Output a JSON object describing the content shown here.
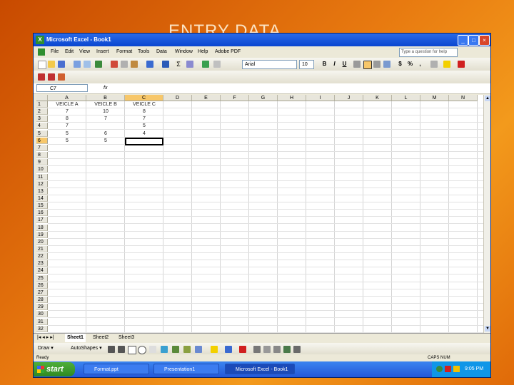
{
  "slide": {
    "title": "ENTRY DATA"
  },
  "window": {
    "title": "Microsoft Excel - Book1",
    "app_icon": "X",
    "minimize": "_",
    "maximize": "□",
    "close": "×"
  },
  "menu": {
    "items": [
      "File",
      "Edit",
      "View",
      "Insert",
      "Format",
      "Tools",
      "Data",
      "Window",
      "Help",
      "Adobe PDF"
    ],
    "help_placeholder": "Type a question for help"
  },
  "format_toolbar": {
    "font_name": "Arial",
    "font_size": "10",
    "bold": "B",
    "italic": "I",
    "underline": "U",
    "currency": "$",
    "percent": "%",
    "comma": ","
  },
  "formula_bar": {
    "name_box": "C7",
    "fx": "fx",
    "value": ""
  },
  "sheet": {
    "columns": [
      "A",
      "B",
      "C",
      "D",
      "E",
      "F",
      "G",
      "H",
      "I",
      "J",
      "K",
      "L",
      "M",
      "N"
    ],
    "rows": [
      "1",
      "2",
      "3",
      "4",
      "5",
      "6",
      "7",
      "8",
      "9",
      "10",
      "11",
      "12",
      "13",
      "14",
      "15",
      "16",
      "17",
      "18",
      "19",
      "20",
      "21",
      "22",
      "23",
      "24",
      "25",
      "26",
      "27",
      "28",
      "29",
      "30",
      "31",
      "32"
    ],
    "cells": [
      {
        "row": 1,
        "col": "A",
        "value": "VEICLE A"
      },
      {
        "row": 1,
        "col": "B",
        "value": "VEICLE B"
      },
      {
        "row": 1,
        "col": "C",
        "value": "VEICLE C"
      },
      {
        "row": 2,
        "col": "A",
        "value": "7"
      },
      {
        "row": 2,
        "col": "B",
        "value": "10"
      },
      {
        "row": 2,
        "col": "C",
        "value": "8"
      },
      {
        "row": 3,
        "col": "A",
        "value": "8"
      },
      {
        "row": 3,
        "col": "B",
        "value": "7"
      },
      {
        "row": 3,
        "col": "C",
        "value": "7"
      },
      {
        "row": 4,
        "col": "A",
        "value": "7"
      },
      {
        "row": 4,
        "col": "B",
        "value": ""
      },
      {
        "row": 4,
        "col": "C",
        "value": "5"
      },
      {
        "row": 5,
        "col": "A",
        "value": "5"
      },
      {
        "row": 5,
        "col": "B",
        "value": "6"
      },
      {
        "row": 5,
        "col": "C",
        "value": "4"
      },
      {
        "row": 6,
        "col": "A",
        "value": "5"
      },
      {
        "row": 6,
        "col": "B",
        "value": "5"
      }
    ],
    "selected_col": "C",
    "selected_row": "6"
  },
  "tabs": {
    "nav": "|◂ ◂ ▸ ▸|",
    "items": [
      "Sheet1",
      "Sheet2",
      "Sheet3"
    ],
    "active": "Sheet1"
  },
  "draw_toolbar": {
    "draw": "Draw ▾",
    "autoshapes": "AutoShapes ▾"
  },
  "status": {
    "left": "Ready",
    "right": "CAPS NUM"
  },
  "taskbar": {
    "start": "start",
    "tasks": [
      "Format.ppt",
      "Presentation1",
      "Microsoft Excel - Book1"
    ],
    "active_task": 2,
    "clock": "9:05 PM"
  },
  "colors": {
    "accent": "#f7c76a",
    "title_bar": "#0a46d0",
    "start_green": "#3a9a2a"
  }
}
